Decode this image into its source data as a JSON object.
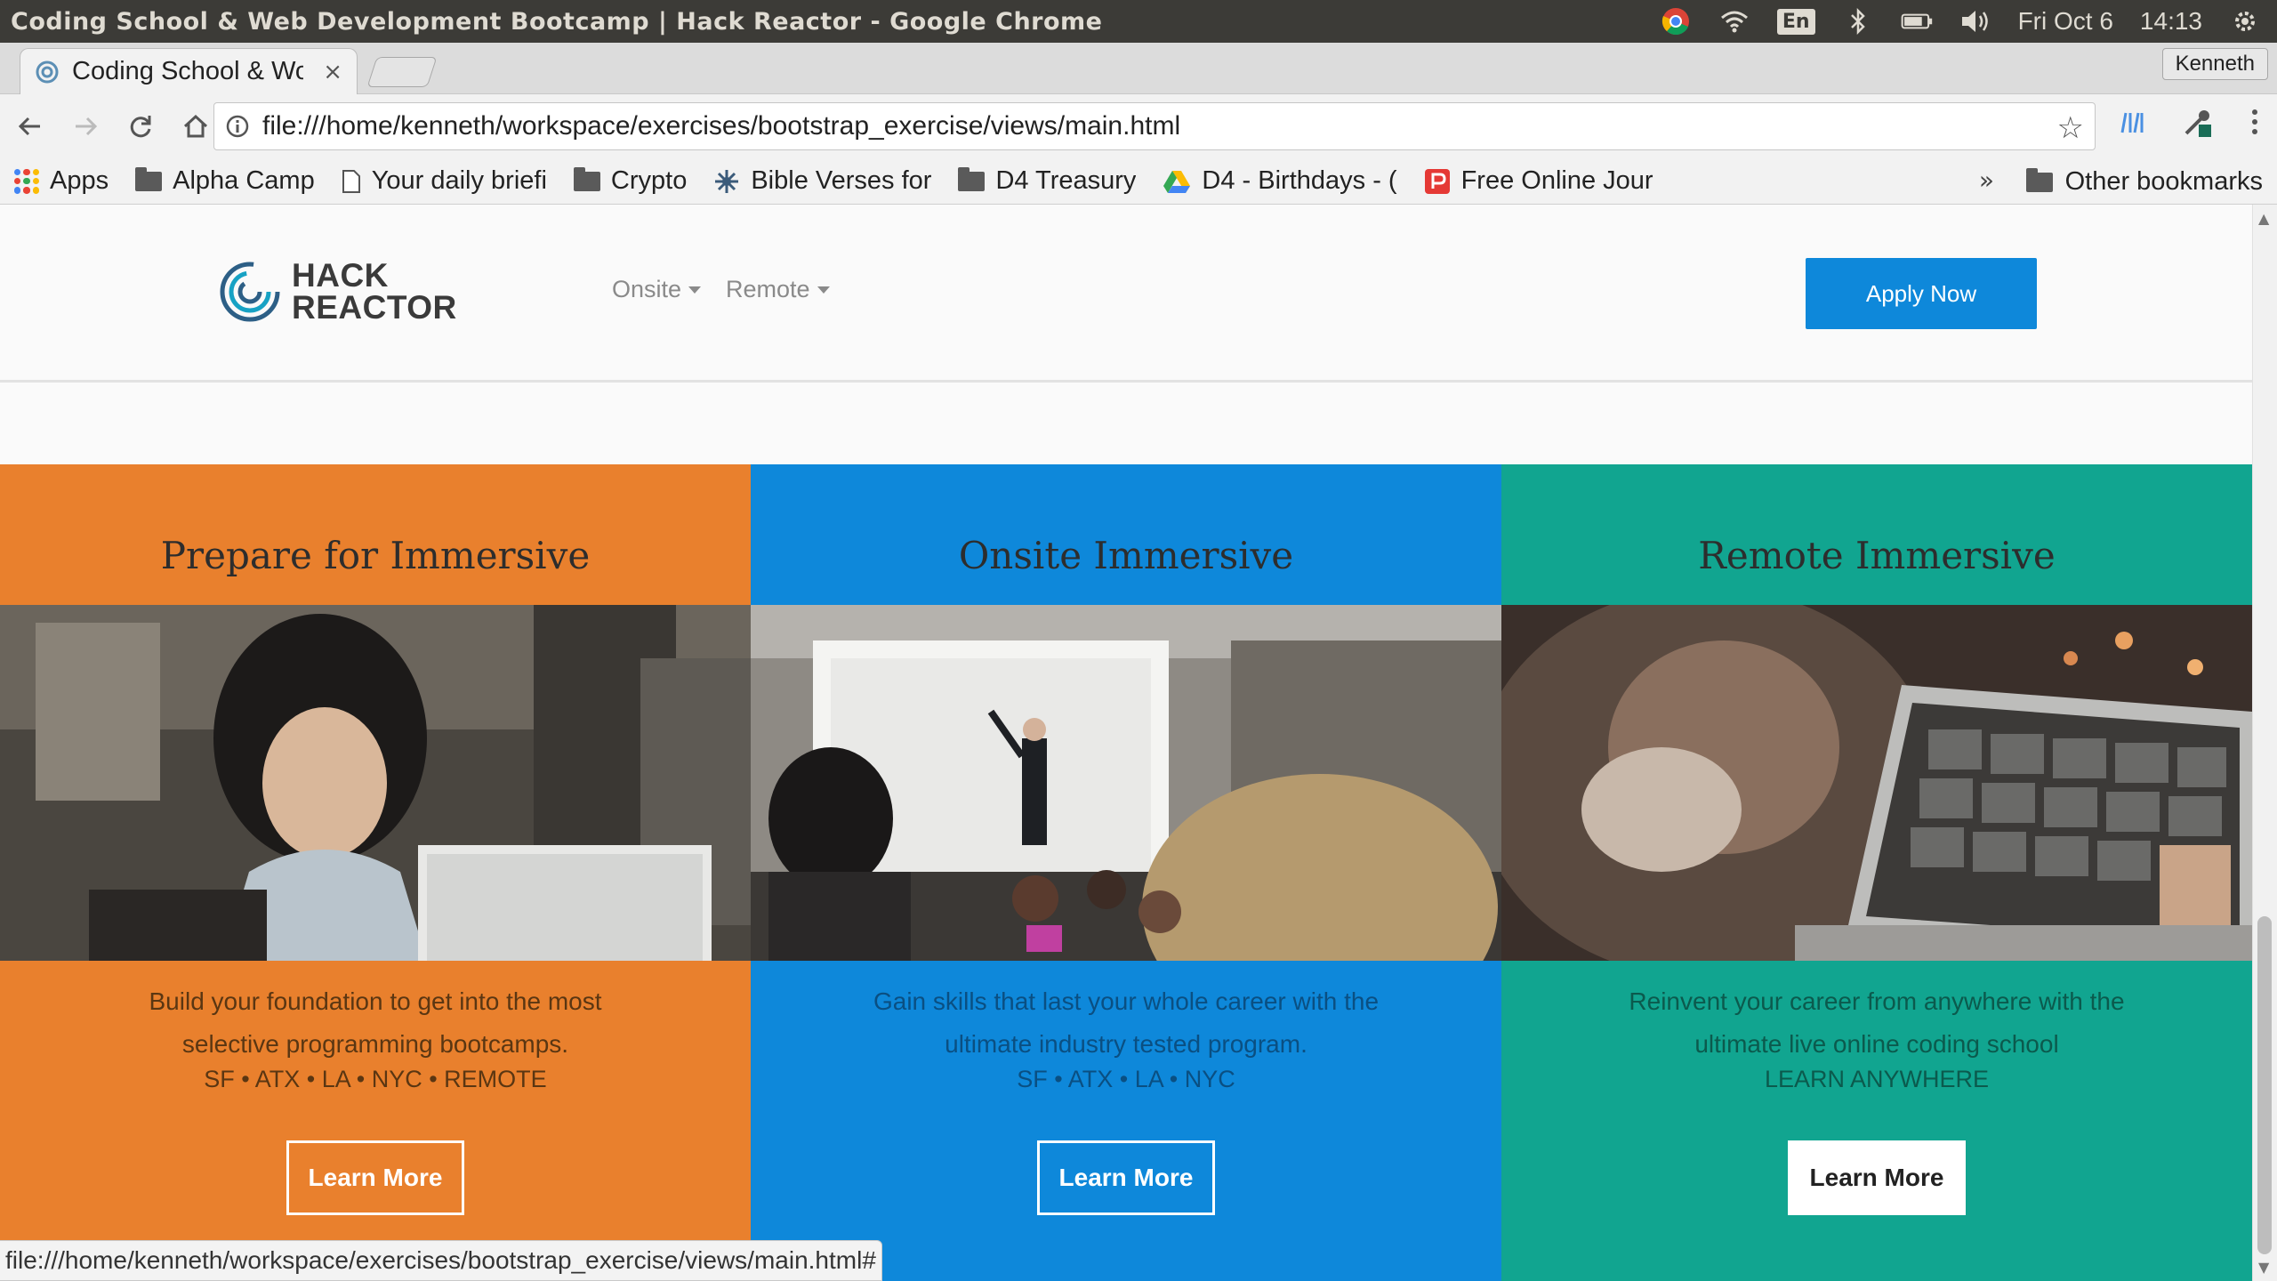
{
  "os": {
    "window_title": "Coding School & Web Development Bootcamp | Hack Reactor - Google Chrome",
    "lang": "En",
    "date": "Fri Oct  6",
    "time": "14:13"
  },
  "tab": {
    "title": "Coding School & Wo",
    "close": "×"
  },
  "profile": "Kenneth",
  "toolbar": {
    "url": "file:///home/kenneth/workspace/exercises/bootstrap_exercise/views/main.html"
  },
  "bookmarks": {
    "items": [
      {
        "label": "Apps",
        "icon": "apps-grid-icon"
      },
      {
        "label": "Alpha Camp",
        "icon": "folder-icon"
      },
      {
        "label": "Your daily briefi",
        "icon": "page-icon"
      },
      {
        "label": "Crypto",
        "icon": "folder-icon"
      },
      {
        "label": "Bible Verses for",
        "icon": "star-burst-icon"
      },
      {
        "label": "D4 Treasury",
        "icon": "folder-icon"
      },
      {
        "label": "D4 - Birthdays - (",
        "icon": "drive-icon"
      },
      {
        "label": "Free Online Jour",
        "icon": "journal-icon"
      }
    ],
    "more": "»",
    "other": "Other bookmarks"
  },
  "site": {
    "logo_line1": "HACK",
    "logo_line2": "REACTOR",
    "nav": [
      "Onsite",
      "Remote"
    ],
    "apply": "Apply Now"
  },
  "columns": [
    {
      "title": "Prepare for Immersive",
      "desc": "Build your foundation to get into the most selective programming bootcamps.",
      "locations": "SF • ATX • LA • NYC • REMOTE",
      "button": "Learn More",
      "bg": "#e9802d"
    },
    {
      "title": "Onsite Immersive",
      "desc": "Gain skills that last your whole career with the ultimate industry tested program.",
      "locations": "SF • ATX • LA • NYC",
      "button": "Learn More",
      "bg": "#0e88da"
    },
    {
      "title": "Remote Immersive",
      "desc": "Reinvent your career from anywhere with the ultimate live online coding school",
      "locations": "LEARN ANYWHERE",
      "button": "Learn More",
      "bg": "#11a590"
    }
  ],
  "status_url": "file:///home/kenneth/workspace/exercises/bootstrap_exercise/views/main.html#"
}
